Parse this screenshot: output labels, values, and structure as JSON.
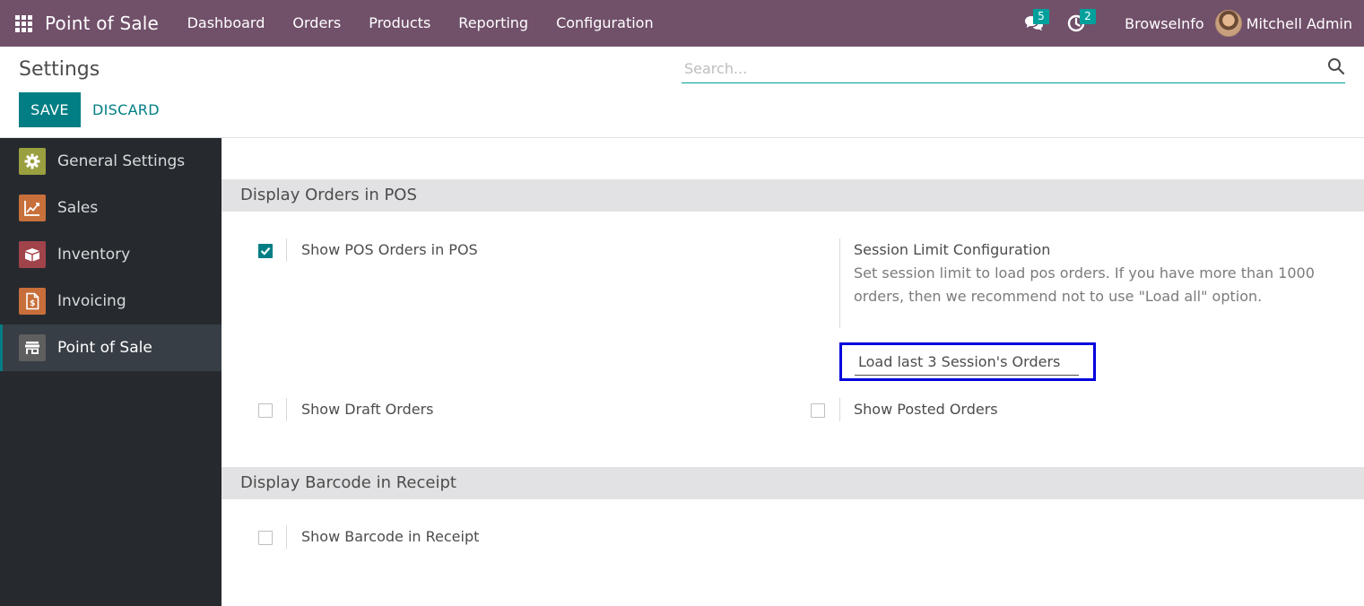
{
  "navbar": {
    "app_name": "Point of Sale",
    "menu": [
      "Dashboard",
      "Orders",
      "Products",
      "Reporting",
      "Configuration"
    ],
    "messages_count": "5",
    "activities_count": "2",
    "company": "BrowseInfo",
    "user": "Mitchell Admin"
  },
  "control_panel": {
    "title": "Settings",
    "search_placeholder": "Search...",
    "save_label": "SAVE",
    "discard_label": "DISCARD"
  },
  "sidebar": {
    "items": [
      {
        "label": "General Settings",
        "icon": "gear-icon",
        "color": "#9a9f3f"
      },
      {
        "label": "Sales",
        "icon": "chart-icon",
        "color": "#c8703b"
      },
      {
        "label": "Inventory",
        "icon": "box-icon",
        "color": "#a1434b"
      },
      {
        "label": "Invoicing",
        "icon": "invoice-icon",
        "color": "#c76e3a"
      },
      {
        "label": "Point of Sale",
        "icon": "store-icon",
        "color": "#5f5f5f"
      }
    ],
    "active_index": 4
  },
  "sections": {
    "display_orders": {
      "title": "Display Orders in POS",
      "show_pos_orders": {
        "label": "Show POS Orders in POS",
        "checked": true
      },
      "session_limit": {
        "title": "Session Limit Configuration",
        "help": "Set session limit to load pos orders. If you have more than 1000 orders, then we recommend not to use \"Load all\" option.",
        "value": "Load last 3 Session's Orders"
      },
      "show_draft": {
        "label": "Show Draft Orders",
        "checked": false
      },
      "show_posted": {
        "label": "Show Posted Orders",
        "checked": false
      }
    },
    "display_barcode": {
      "title": "Display Barcode in Receipt",
      "show_barcode": {
        "label": "Show Barcode in Receipt",
        "checked": false
      }
    }
  },
  "colors": {
    "navbar": "#71506a",
    "primary": "#017e84",
    "highlight_border": "#0000dd"
  }
}
